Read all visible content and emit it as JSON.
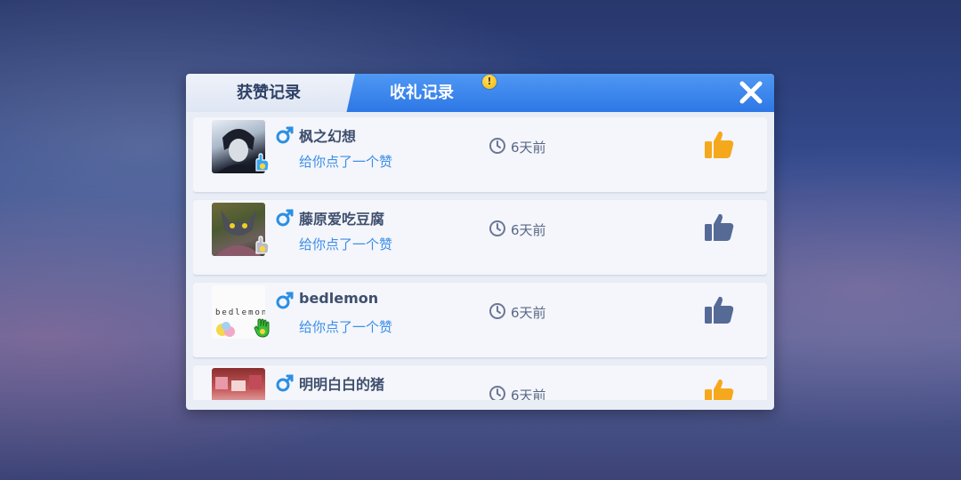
{
  "tabs": {
    "praise_label": "获赞记录",
    "gift_label": "收礼记录",
    "gift_alert": "!"
  },
  "rows": [
    {
      "name": "枫之幻想",
      "action": "给你点了一个赞",
      "time": "6天前",
      "liked": true,
      "badge": "blue-hand"
    },
    {
      "name": "藤原爱吃豆腐",
      "action": "给你点了一个赞",
      "time": "6天前",
      "liked": false,
      "badge": "gray-hand"
    },
    {
      "name": "bedlemon",
      "action": "给你点了一个赞",
      "time": "6天前",
      "liked": false,
      "badge": "green-hand",
      "avatar_text": "bedlemon"
    },
    {
      "name": "明明白白的猪",
      "action": "",
      "time": "6天前",
      "liked": true,
      "badge": "none"
    }
  ],
  "colors": {
    "accent": "#2d77e6",
    "like_active": "#f6a81d",
    "like_inactive": "#566a96",
    "male": "#2b8fe3"
  },
  "icons": [
    "close-icon",
    "male-icon",
    "clock-icon",
    "thumbs-up-icon",
    "alert-icon"
  ]
}
